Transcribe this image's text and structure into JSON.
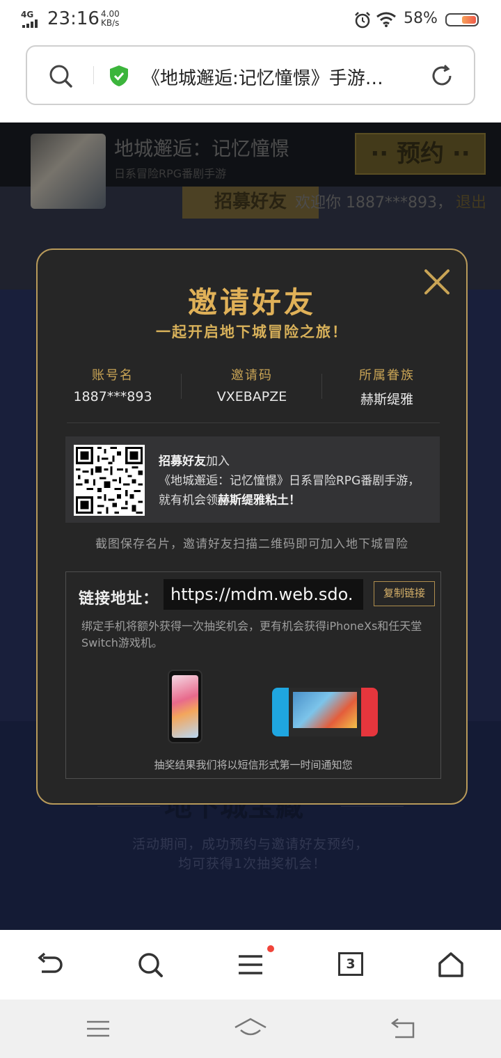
{
  "status_bar": {
    "network": "4G",
    "time": "23:16",
    "speed_value": "4.00",
    "speed_unit": "KB/s",
    "battery_percent": "58%"
  },
  "url_bar": {
    "page_title": "《地城邂逅:记忆憧憬》手游…"
  },
  "background_page": {
    "game_name": "地城邂逅：记忆憧憬",
    "game_subtitle": "日系冒险RPG番剧手游",
    "reserve_label": "·· 预约 ··",
    "recruit_label": "招募好友",
    "welcome_text": "欢迎你  1887***893，",
    "logout_label": "退出",
    "section_title": "地下城宝藏",
    "section_line1": "活动期间，成功预约与邀请好友预约，",
    "section_line2": "均可获得1次抽奖机会！"
  },
  "modal": {
    "title": "邀请好友",
    "subtitle": "一起开启地下城冒险之旅！",
    "info": [
      {
        "label": "账号名",
        "value": "1887***893"
      },
      {
        "label": "邀请码",
        "value": "VXEBAPZE"
      },
      {
        "label": "所属眷族",
        "value": "赫斯缇雅"
      }
    ],
    "qr_line1_bold": "招募好友",
    "qr_line1_rest": "加入",
    "qr_line2": "《地城邂逅：记忆憧憬》日系冒险RPG番剧手游，",
    "qr_line3_rest": "就有机会领",
    "qr_line3_bold": "赫斯缇雅粘土！",
    "save_hint": "截图保存名片，邀请好友扫描二维码即可加入地下城冒险",
    "link_label": "链接地址：",
    "link_url": "https://mdm.web.sdo.",
    "copy_label": "复制链接",
    "link_desc": "绑定手机将额外获得一次抽奖机会，更有机会获得iPhoneXs和任天堂Switch游戏机。",
    "lottery_note": "抽奖结果我们将以短信形式第一时间通知您"
  },
  "toolbar": {
    "tabs_count": "3"
  },
  "colors": {
    "accent_gold": "#e0b158",
    "modal_bg": "#262626",
    "page_blue": "#2e3a6c"
  }
}
